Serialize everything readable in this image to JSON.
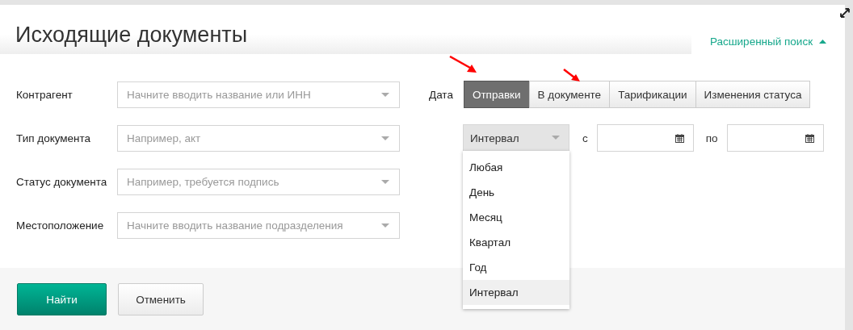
{
  "title": "Исходящие документы",
  "advanced_search": {
    "label": "Расширенный поиск",
    "expanded": true
  },
  "filters": [
    {
      "label": "Контрагент",
      "placeholder": "Начните вводить название или ИНН"
    },
    {
      "label": "Тип документа",
      "placeholder": "Например, акт"
    },
    {
      "label": "Статус документа",
      "placeholder": "Например, требуется подпись"
    },
    {
      "label": "Местоположение",
      "placeholder": "Начните вводить название подразделения"
    }
  ],
  "date": {
    "label": "Дата",
    "tabs": [
      {
        "label": "Отправки",
        "selected": true
      },
      {
        "label": "В документе",
        "selected": false
      },
      {
        "label": "Тарификации",
        "selected": false
      },
      {
        "label": "Изменения статуса",
        "selected": false
      }
    ],
    "period": {
      "value": "Интервал",
      "expanded": true,
      "options": [
        {
          "label": "Любая",
          "selected": false
        },
        {
          "label": "День",
          "selected": false
        },
        {
          "label": "Месяц",
          "selected": false
        },
        {
          "label": "Квартал",
          "selected": false
        },
        {
          "label": "Год",
          "selected": false
        },
        {
          "label": "Интервал",
          "selected": true
        }
      ]
    },
    "from_label": "с",
    "to_label": "по"
  },
  "buttons": [
    {
      "label": "Найти",
      "kind": "primary"
    },
    {
      "label": "Отменить",
      "kind": "secondary"
    }
  ]
}
